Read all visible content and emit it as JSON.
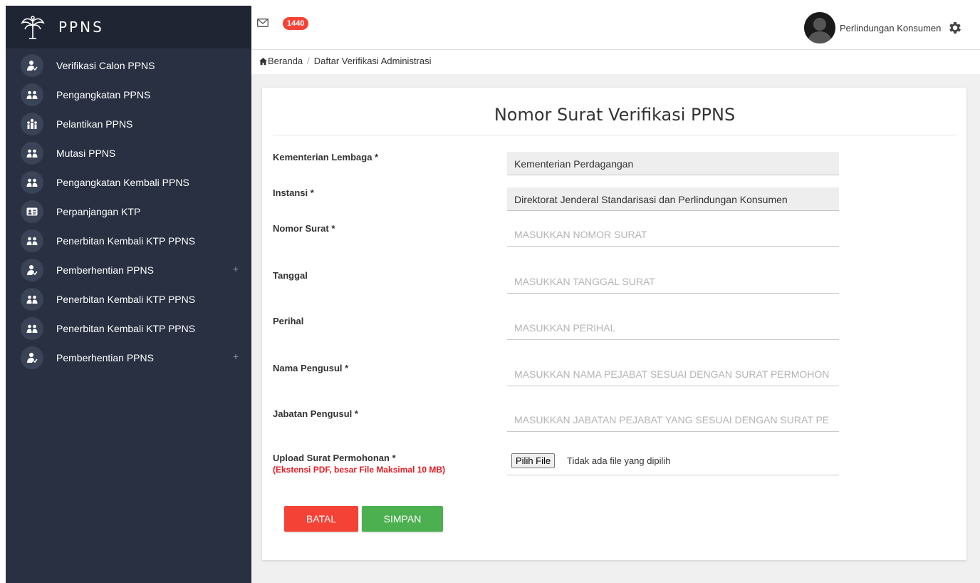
{
  "brand": {
    "title": "PPNS"
  },
  "sidebar": {
    "items": [
      {
        "label": "Verifikasi Calon PPNS",
        "icon": "user-check-icon",
        "expandable": false
      },
      {
        "label": "Pengangkatan PPNS",
        "icon": "users-icon",
        "expandable": false
      },
      {
        "label": "Pelantikan PPNS",
        "icon": "group-icon",
        "expandable": false
      },
      {
        "label": "Mutasi PPNS",
        "icon": "users-icon",
        "expandable": false
      },
      {
        "label": "Pengangkatan Kembali PPNS",
        "icon": "users-icon",
        "expandable": false
      },
      {
        "label": "Perpanjangan KTP",
        "icon": "id-card-icon",
        "expandable": false
      },
      {
        "label": "Penerbitan Kembali KTP PPNS",
        "icon": "users-icon",
        "expandable": false
      },
      {
        "label": "Pemberhentian PPNS",
        "icon": "user-check-icon",
        "expandable": true,
        "plus": "+"
      },
      {
        "label": "Penerbitan Kembali KTP PPNS",
        "icon": "users-icon",
        "expandable": false
      },
      {
        "label": "Penerbitan Kembali KTP PPNS",
        "icon": "users-icon",
        "expandable": false
      },
      {
        "label": "Pemberhentian PPNS",
        "icon": "user-check-icon",
        "expandable": true,
        "plus": "+"
      }
    ]
  },
  "topbar": {
    "mail_icon": "envelope-icon",
    "mail_count": "1440",
    "user_name": "Perlindungan Konsumen",
    "settings_icon": "gear-icon"
  },
  "breadcrumb": {
    "home": "Beranda",
    "current": "Daftar Verifikasi Administrasi"
  },
  "form": {
    "title": "Nomor Surat Verifikasi PPNS",
    "fields": {
      "kementerian": {
        "label": "Kementerian Lembaga *",
        "value": "Kementerian Perdagangan"
      },
      "instansi": {
        "label": "Instansi *",
        "value": "Direktorat Jenderal Standarisasi dan Perlindungan Konsumen"
      },
      "nomor_surat": {
        "label": "Nomor Surat *",
        "placeholder": "MASUKKAN NOMOR SURAT"
      },
      "tanggal": {
        "label": "Tanggal",
        "placeholder": "MASUKKAN TANGGAL SURAT"
      },
      "perihal": {
        "label": "Perihal",
        "placeholder": "MASUKKAN PERIHAL"
      },
      "nama_pengusul": {
        "label": "Nama Pengusul *",
        "placeholder": "MASUKKAN NAMA PEJABAT SESUAI DENGAN SURAT PERMOHON"
      },
      "jabatan_pengusul": {
        "label": "Jabatan Pengusul *",
        "placeholder": "MASUKKAN JABATAN PEJABAT YANG SESUAI DENGAN SURAT PE"
      },
      "upload": {
        "label": "Upload Surat Permohonan *",
        "hint": "(Ekstensi PDF, besar File Maksimal 10 MB)",
        "button": "Pilih File",
        "status": "Tidak ada file yang dipilih"
      }
    },
    "buttons": {
      "cancel": "BATAL",
      "save": "SIMPAN"
    }
  },
  "colors": {
    "sidebar_bg": "#283042",
    "brand_bg": "#1f2533",
    "badge": "#f44336",
    "cancel": "#f44336",
    "save": "#4caf50",
    "hint": "#e51c23"
  }
}
